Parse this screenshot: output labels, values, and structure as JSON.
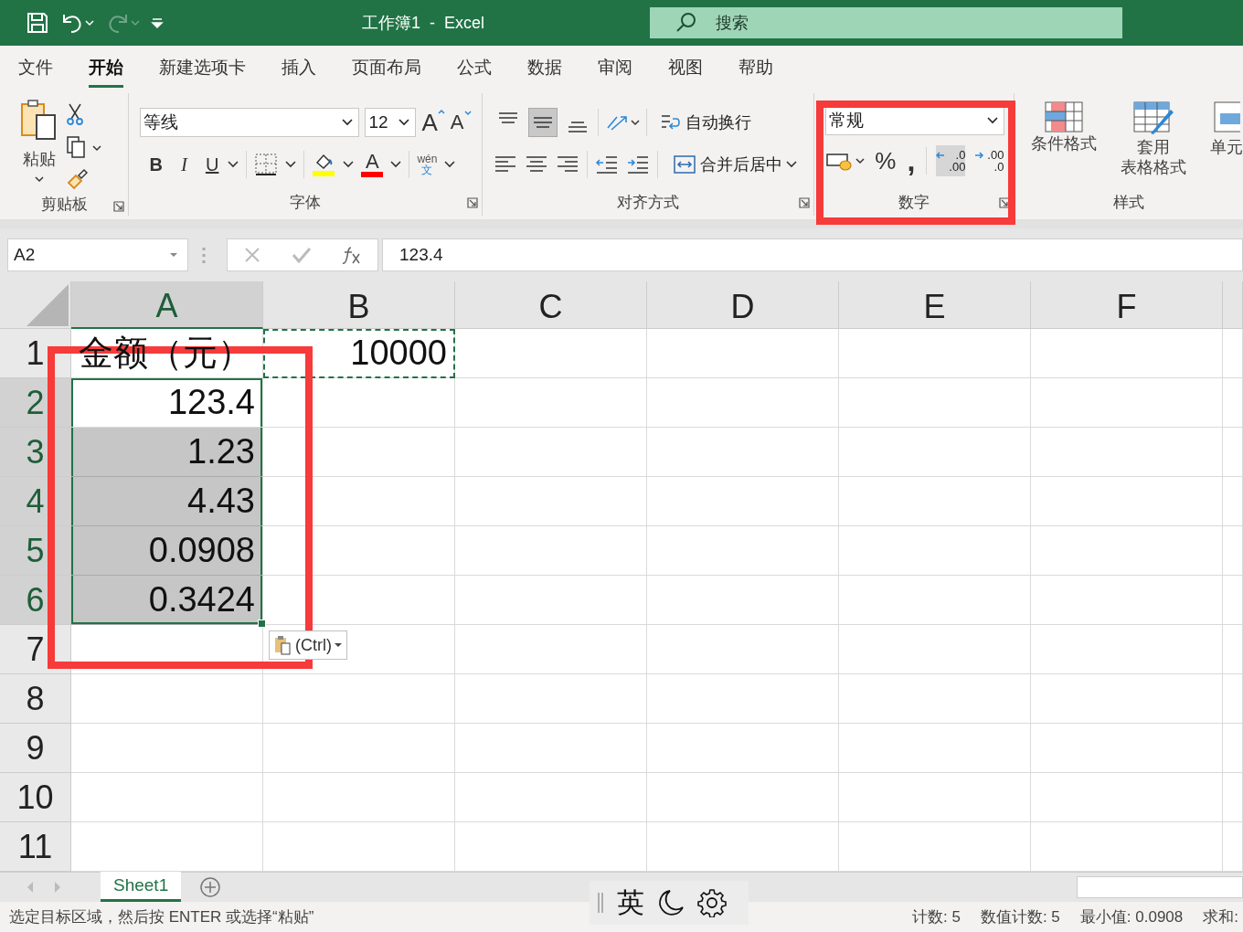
{
  "quick_access": [
    {
      "kind": "save",
      "disabled": false
    },
    {
      "kind": "undo",
      "disabled": false
    },
    {
      "kind": "redo",
      "disabled": true
    },
    {
      "kind": "customize",
      "disabled": false
    }
  ],
  "window": {
    "title": "工作簿1  -  Excel"
  },
  "search": {
    "placeholder": "搜索"
  },
  "menu_tabs": [
    {
      "label": "文件",
      "selected": false
    },
    {
      "label": "开始",
      "selected": true
    },
    {
      "label": "新建选项卡",
      "selected": false
    },
    {
      "label": "插入",
      "selected": false
    },
    {
      "label": "页面布局",
      "selected": false
    },
    {
      "label": "公式",
      "selected": false
    },
    {
      "label": "数据",
      "selected": false
    },
    {
      "label": "审阅",
      "selected": false
    },
    {
      "label": "视图",
      "selected": false
    },
    {
      "label": "帮助",
      "selected": false
    }
  ],
  "ribbon": {
    "clipboard": {
      "paste": "粘贴",
      "label": "剪贴板"
    },
    "font": {
      "font_name": "等线",
      "font_size": "12",
      "grow": "A",
      "shrink": "A",
      "bold": "B",
      "italic": "I",
      "underline": "U",
      "font_color": "A",
      "phonetic_top": "wén",
      "phonetic_bottom": "文",
      "label": "字体"
    },
    "alignment": {
      "buttons": [
        {
          "kind": "top",
          "selected": false
        },
        {
          "kind": "middle",
          "selected": true
        },
        {
          "kind": "bottom",
          "selected": false
        }
      ],
      "wrap_text": "自动换行",
      "merge_center": "合并后居中",
      "label": "对齐方式"
    },
    "number": {
      "format": "常规",
      "percent": "%",
      "comma": ",",
      "decimal_buttons": [
        {
          "kind": "increase",
          "top": ".0",
          "bottom": ".00",
          "selected": true
        },
        {
          "kind": "decrease",
          "top": ".00",
          "bottom": ".0",
          "selected": false
        }
      ],
      "label": "数字"
    },
    "styles": {
      "buttons": [
        {
          "kind": "conditional",
          "lines": [
            "条件格式"
          ]
        },
        {
          "kind": "table",
          "lines": [
            "套用",
            "表格格式"
          ]
        },
        {
          "kind": "cell",
          "lines": [
            "单元"
          ]
        }
      ],
      "label": "样式"
    }
  },
  "formula_bar": {
    "name_box": "A2",
    "value": "123.4"
  },
  "columns": [
    {
      "label": "A",
      "selected": true
    },
    {
      "label": "B",
      "selected": false
    },
    {
      "label": "C",
      "selected": false
    },
    {
      "label": "D",
      "selected": false
    },
    {
      "label": "E",
      "selected": false
    },
    {
      "label": "F",
      "selected": false
    }
  ],
  "rows": [
    {
      "header": "1",
      "selected": false,
      "cells": [
        {
          "text": "金额（元）",
          "kind": "text",
          "selected": false,
          "active": false,
          "copied": false
        },
        {
          "text": "10000",
          "kind": "number",
          "selected": false,
          "active": false,
          "copied": true
        }
      ]
    },
    {
      "header": "2",
      "selected": true,
      "cells": [
        {
          "text": "123.4",
          "kind": "number",
          "selected": true,
          "active": true,
          "copied": false
        }
      ]
    },
    {
      "header": "3",
      "selected": true,
      "cells": [
        {
          "text": "1.23",
          "kind": "number",
          "selected": true,
          "active": false,
          "copied": false
        }
      ]
    },
    {
      "header": "4",
      "selected": true,
      "cells": [
        {
          "text": "4.43",
          "kind": "number",
          "selected": true,
          "active": false,
          "copied": false
        }
      ]
    },
    {
      "header": "5",
      "selected": true,
      "cells": [
        {
          "text": "0.0908",
          "kind": "number",
          "selected": true,
          "active": false,
          "copied": false
        }
      ]
    },
    {
      "header": "6",
      "selected": true,
      "cells": [
        {
          "text": "0.3424",
          "kind": "number",
          "selected": true,
          "active": false,
          "copied": false
        }
      ]
    },
    {
      "header": "7",
      "selected": false
    },
    {
      "header": "8",
      "selected": false
    },
    {
      "header": "9",
      "selected": false
    },
    {
      "header": "10",
      "selected": false
    },
    {
      "header": "11",
      "selected": false
    }
  ],
  "paste_options": {
    "label": "(Ctrl)"
  },
  "sheet_tabs": [
    {
      "label": "Sheet1",
      "selected": true
    }
  ],
  "status_bar": {
    "message": "选定目标区域，然后按 ENTER 或选择“粘贴”",
    "stats": [
      "计数: 5",
      "数值计数: 5",
      "最小值: 0.0908",
      "求和:"
    ]
  },
  "ime_bar": {
    "mode": "英"
  }
}
